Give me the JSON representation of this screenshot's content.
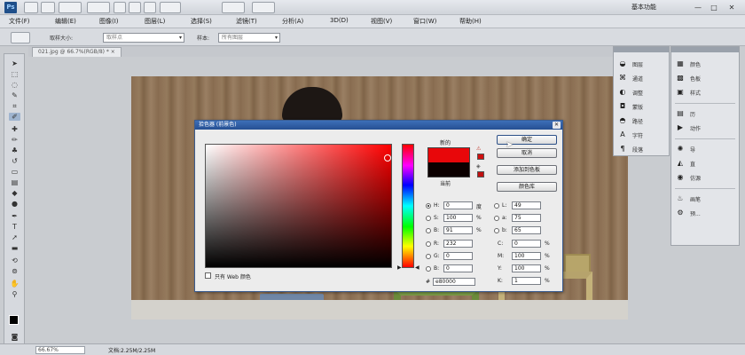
{
  "app": {
    "logo": "Ps",
    "workspace": "基本功能",
    "window_controls": [
      "—",
      "□",
      "✕"
    ]
  },
  "menu": [
    "文件(F)",
    "编辑(E)",
    "图像(I)",
    "图层(L)",
    "选择(S)",
    "滤镜(T)",
    "分析(A)",
    "3D(D)",
    "视图(V)",
    "窗口(W)",
    "帮助(H)"
  ],
  "options_bar": {
    "sample_size_label": "取样大小:",
    "sample_size_value": "取样点",
    "sample_label": "样本:",
    "sample_value": "所有图层"
  },
  "document": {
    "tab_title": "021.jpg @ 66.7%(RGB/8) * ×",
    "zoom": "66.67%",
    "doc_info": "文档:2.25M/2.25M"
  },
  "panels": {
    "left_column": [
      {
        "icon": "swatch-icon",
        "label": "图层"
      },
      {
        "icon": "channels-icon",
        "label": "通道"
      },
      {
        "icon": "adjust-icon",
        "label": "调整"
      },
      {
        "icon": "mask-icon",
        "label": "蒙版"
      },
      {
        "icon": "paths-icon",
        "label": "路径"
      },
      {
        "icon": "char-icon",
        "label": "字符"
      },
      {
        "icon": "para-icon",
        "label": "段落"
      }
    ],
    "right_column": [
      {
        "icon": "palette-icon",
        "label": "颜色"
      },
      {
        "icon": "swatches-icon",
        "label": "色板"
      },
      {
        "icon": "styles-icon",
        "label": "样式"
      },
      {
        "icon": "history-icon",
        "label": "历"
      },
      {
        "icon": "actions-icon",
        "label": "动作"
      },
      {
        "icon": "nav-icon",
        "label": "导"
      },
      {
        "icon": "info-icon",
        "label": "直"
      },
      {
        "icon": "clone-icon",
        "label": "仿源"
      },
      {
        "icon": "tool-preset-icon",
        "label": "画笔"
      },
      {
        "icon": "brush-icon",
        "label": "预..."
      }
    ]
  },
  "color_picker": {
    "title": "拾色器 (前景色)",
    "close": "✕",
    "new_label": "新的",
    "current_label": "当前",
    "new_color": "#e8070a",
    "current_color": "#0c0000",
    "buttons": {
      "ok": "确定",
      "cancel": "取消",
      "add_swatches": "添加到色板",
      "color_libraries": "颜色库"
    },
    "hsb": [
      {
        "label": "H:",
        "value": "0",
        "unit": "度",
        "checked": true
      },
      {
        "label": "S:",
        "value": "100",
        "unit": "%",
        "checked": false
      },
      {
        "label": "B:",
        "value": "91",
        "unit": "%",
        "checked": false
      }
    ],
    "rgb": [
      {
        "label": "R:",
        "value": "232",
        "unit": "",
        "checked": false
      },
      {
        "label": "G:",
        "value": "0",
        "unit": "",
        "checked": false
      },
      {
        "label": "B:",
        "value": "0",
        "unit": "",
        "checked": false
      }
    ],
    "lab": [
      {
        "label": "L:",
        "value": "49",
        "unit": ""
      },
      {
        "label": "a:",
        "value": "75",
        "unit": ""
      },
      {
        "label": "b:",
        "value": "65",
        "unit": ""
      }
    ],
    "cmyk": [
      {
        "label": "C:",
        "value": "0",
        "unit": "%"
      },
      {
        "label": "M:",
        "value": "100",
        "unit": "%"
      },
      {
        "label": "Y:",
        "value": "100",
        "unit": "%"
      },
      {
        "label": "K:",
        "value": "1",
        "unit": "%"
      }
    ],
    "web_only_label": "只有 Web 颜色",
    "hex_prefix": "#",
    "hex_value": "e80000"
  }
}
